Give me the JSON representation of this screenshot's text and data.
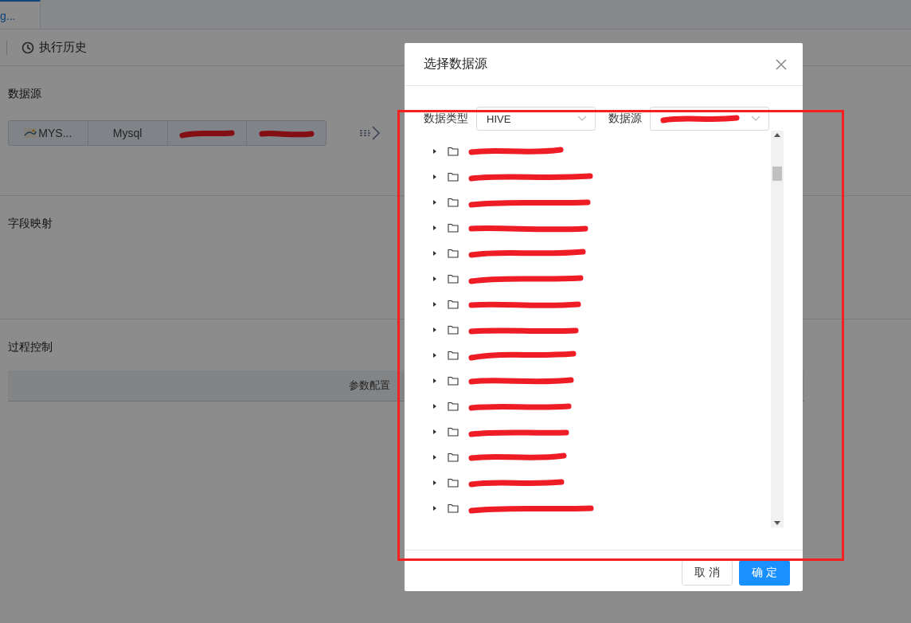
{
  "tabs": [
    {
      "label": "g...",
      "selected": true
    }
  ],
  "toolbar": {
    "history_button": "执行历史"
  },
  "sections": [
    {
      "title": "数据源",
      "kind": "source"
    },
    {
      "title": "字段映射",
      "kind": "mapping"
    },
    {
      "title": "过程控制",
      "kind": "control"
    }
  ],
  "source_card": {
    "cells": [
      {
        "kind": "logo",
        "text": "MYS..."
      },
      {
        "kind": "text",
        "text": "Mysql"
      },
      {
        "kind": "redacted"
      },
      {
        "kind": "redacted"
      }
    ]
  },
  "control_table": {
    "columns": [
      "参数配置"
    ]
  },
  "dialog": {
    "title": "选择数据源",
    "filters": [
      {
        "label": "数据类型",
        "kind": "select",
        "value": "HIVE"
      },
      {
        "label": "数据源",
        "kind": "redacted"
      }
    ],
    "tree": [
      {
        "expanded": false
      },
      {
        "expanded": false
      },
      {
        "expanded": false
      },
      {
        "expanded": false
      },
      {
        "expanded": false
      },
      {
        "expanded": false
      },
      {
        "expanded": false
      },
      {
        "expanded": false
      },
      {
        "expanded": false
      },
      {
        "expanded": false
      },
      {
        "expanded": false
      },
      {
        "expanded": false
      },
      {
        "expanded": false
      },
      {
        "expanded": false
      },
      {
        "expanded": false
      }
    ],
    "buttons": [
      {
        "label": "取 消",
        "kind": "secondary"
      },
      {
        "label": "确 定",
        "kind": "primary"
      }
    ]
  }
}
